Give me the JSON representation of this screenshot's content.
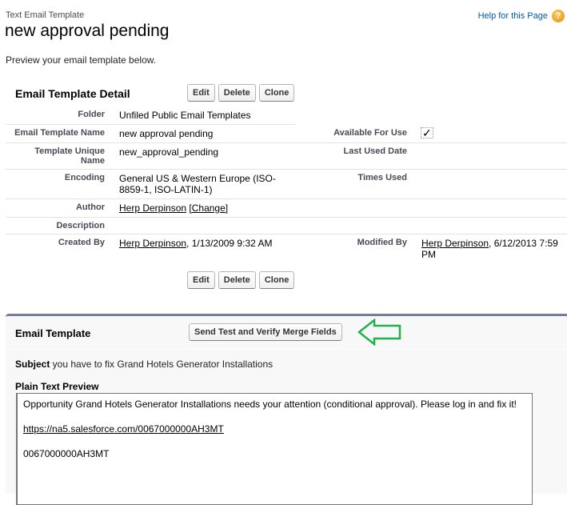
{
  "header": {
    "page_type": "Text Email Template",
    "title": "new approval pending",
    "help_link": "Help for this Page",
    "help_icon": "question-mark-icon",
    "intro": "Preview your email template below."
  },
  "detail": {
    "section_title": "Email Template Detail",
    "buttons": {
      "edit": "Edit",
      "delete": "Delete",
      "clone": "Clone"
    },
    "fields": {
      "folder_label": "Folder",
      "folder_value": "Unfiled Public Email Templates",
      "name_label": "Email Template Name",
      "name_value": "new approval pending",
      "available_label": "Available For Use",
      "available_value": "✓",
      "unique_label": "Template Unique Name",
      "unique_value": "new_approval_pending",
      "last_used_label": "Last Used Date",
      "last_used_value": "",
      "encoding_label": "Encoding",
      "encoding_value": "General US & Western Europe (ISO-8859-1, ISO-LATIN-1)",
      "times_used_label": "Times Used",
      "times_used_value": "",
      "author_label": "Author",
      "author_value": "Herp Derpinson",
      "author_change": "[Change]",
      "description_label": "Description",
      "description_value": "",
      "created_label": "Created By",
      "created_user": "Herp Derpinson",
      "created_date": ", 1/13/2009 9:32 AM",
      "modified_label": "Modified By",
      "modified_user": "Herp Derpinson",
      "modified_date": ", 6/12/2013 7:59 PM"
    }
  },
  "email_template": {
    "section_title": "Email Template",
    "send_test_button": "Send Test and Verify Merge Fields",
    "annotation_arrow_color": "#22b14c",
    "subject_label": "Subject",
    "subject_value": " you have to fix Grand Hotels Generator Installations",
    "preview_label": "Plain Text Preview",
    "preview_lines": [
      "Opportunity Grand Hotels Generator Installations needs your attention (conditional approval). Please log in and fix it!",
      "https://na5.salesforce.com/0067000000AH3MT",
      "0067000000AH3MT"
    ]
  }
}
